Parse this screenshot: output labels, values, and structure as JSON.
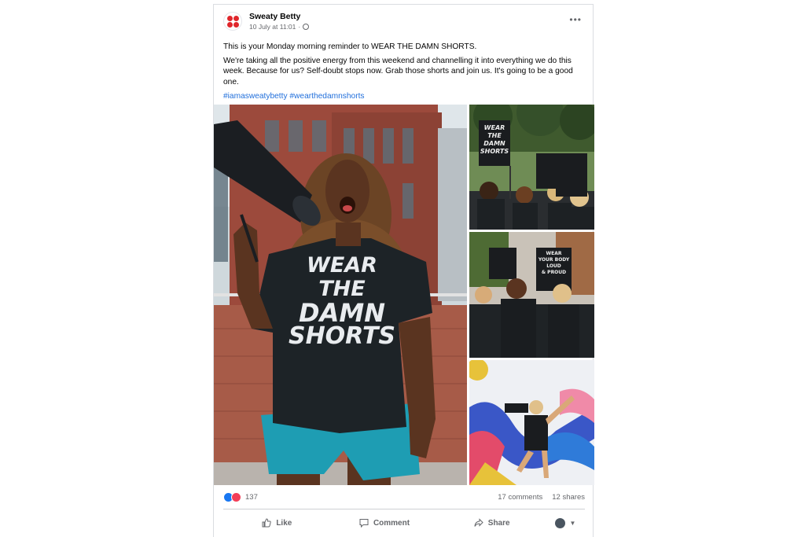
{
  "post": {
    "page_name": "Sweaty Betty",
    "date": "10 July at 11:01",
    "meta_separator": "·",
    "privacy_icon": "globe-icon",
    "more_icon": "more-horizontal-icon",
    "paragraph1": "This is your Monday morning reminder to WEAR THE DAMN SHORTS.",
    "paragraph2": "We're taking all the positive energy from this weekend and channelling it into everything we do this week. Because for us? Self-doubt stops now. Grab those shorts and join us. It's going to be a good one.",
    "hashtags": [
      "#iamasweatybetty",
      "#wearthedamnshorts"
    ]
  },
  "photos": {
    "main_shirt": [
      "WEAR",
      "THE",
      "DAMN",
      "SHORTS"
    ],
    "sign_top": [
      "WEAR",
      "THE",
      "DAMN",
      "SHORTS"
    ],
    "sign_mid": [
      "WEAR",
      "YOUR BODY",
      "LOUD",
      "& PROUD"
    ]
  },
  "stats": {
    "reactions_count": "137",
    "comments": "17 comments",
    "shares": "12 shares",
    "reaction_icons": [
      "like-reaction-icon",
      "love-reaction-icon"
    ]
  },
  "actions": {
    "like": "Like",
    "comment": "Comment",
    "share": "Share"
  },
  "colors": {
    "brand": "#e0262b",
    "link": "#216fdb",
    "muted": "#65676b",
    "like_blue": "#1877f2",
    "love_red": "#f33e58",
    "shorts_teal": "#1e9db3",
    "tshirt": "#1d2327",
    "brick": "#9c4a3c"
  }
}
